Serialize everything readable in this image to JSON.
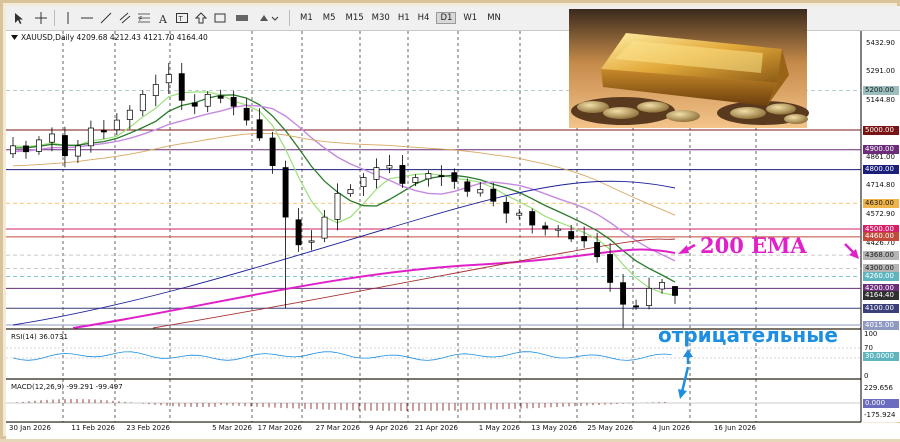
{
  "toolbar": {
    "timeframes": [
      "M1",
      "M5",
      "M15",
      "M30",
      "H1",
      "H4",
      "D1",
      "W1",
      "MN"
    ],
    "active_timeframe": "D1"
  },
  "chart_header": "XAUUSD,Daily  4209.68 4212.43 4121.70 4164.40",
  "price_axis": [
    "5432.90",
    "5291.00",
    "5144.80",
    "4861.00",
    "4714.80",
    "4572.90",
    "4426.70",
    "4100.00"
  ],
  "price_tags": [
    {
      "value": "5200.00",
      "color": "#9bbfbf",
      "text_color": "#1a1a1a"
    },
    {
      "value": "5000.00",
      "color": "#7a1414",
      "text_color": "#ffffff"
    },
    {
      "value": "4900.00",
      "color": "#6b2c7a",
      "text_color": "#ffffff"
    },
    {
      "value": "4800.00",
      "color": "#1a1f7a",
      "text_color": "#ffffff"
    },
    {
      "value": "4630.00",
      "color": "#f0b54a",
      "text_color": "#1a1a1a"
    },
    {
      "value": "4500.00",
      "color": "#d51f6a",
      "text_color": "#ffffff"
    },
    {
      "value": "4460.00",
      "color": "#c24a3a",
      "text_color": "#ffffff"
    },
    {
      "value": "4368.00",
      "color": "#b5b5b5",
      "text_color": "#1a1a1a"
    },
    {
      "value": "4300.00",
      "color": "#b5b5b5",
      "text_color": "#1a1a1a"
    },
    {
      "value": "4260.00",
      "color": "#5fb5bf",
      "text_color": "#ffffff"
    },
    {
      "value": "4200.00",
      "color": "#6b2c7a",
      "text_color": "#ffffff"
    },
    {
      "value": "4164.40",
      "color": "#303030",
      "text_color": "#ffffff"
    },
    {
      "value": "4100.00",
      "color": "#3a3f7a",
      "text_color": "#ffffff"
    },
    {
      "value": "4015.00",
      "color": "#8f9ac2",
      "text_color": "#ffffff"
    }
  ],
  "rsi": {
    "label": "RSI(14) 36.0731",
    "axis": [
      "100",
      "70",
      "30",
      "0"
    ],
    "tag": "30.0000"
  },
  "macd": {
    "label": "MACD(12,26,9) -99.291 -99.497",
    "axis": [
      "229.656",
      "-175.924"
    ],
    "tag": "0.000"
  },
  "dates": [
    "30 Jan 2026",
    "11 Feb 2026",
    "23 Feb 2026",
    "5 Mar 2026",
    "17 Mar 2026",
    "27 Mar 2026",
    "9 Apr 2026",
    "21 Apr 2026",
    "1 May 2026",
    "13 May 2026",
    "25 May 2026",
    "4 Jun 2026",
    "16 Jun 2026"
  ],
  "annotations": {
    "ema": "200 EMA",
    "negative": "отрицательные"
  },
  "colors": {
    "ema200": "#e020c8",
    "annotation": "#e020c8",
    "blue_annotation": "#1e8fe0",
    "candle_up": "#ffffff",
    "candle_down": "#000000"
  },
  "chart_data": {
    "type": "candlestick",
    "symbol": "XAUUSD",
    "timeframe": "Daily",
    "last": {
      "open": 4209.68,
      "high": 4212.43,
      "low": 4121.7,
      "close": 4164.4
    },
    "close_path": [
      4920,
      4890,
      4950,
      4980,
      4870,
      4920,
      5010,
      4990,
      5050,
      5100,
      5180,
      5230,
      5280,
      5150,
      5120,
      5180,
      5160,
      5120,
      5050,
      4960,
      4820,
      4560,
      4420,
      4440,
      4560,
      4680,
      4700,
      4760,
      4810,
      4820,
      4730,
      4760,
      4780,
      4770,
      4740,
      4690,
      4700,
      4640,
      4580,
      4580,
      4520,
      4500,
      4500,
      4450,
      4440,
      4360,
      4230,
      4120,
      4110,
      4200,
      4230,
      4164.4
    ],
    "price_range": [
      4000,
      5500
    ]
  }
}
